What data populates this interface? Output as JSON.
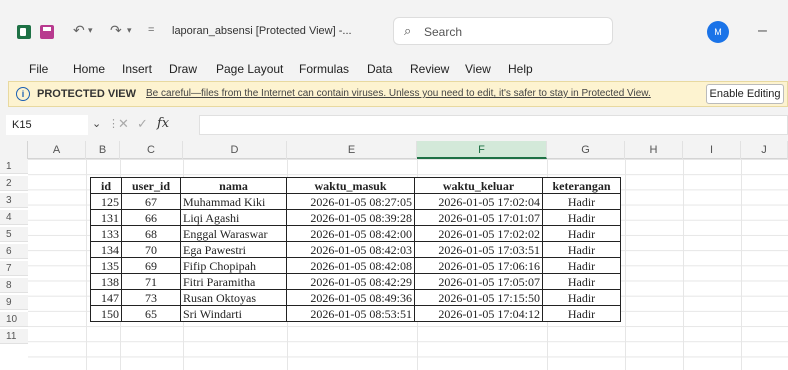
{
  "titlebar": {
    "undo_glyph": "↶",
    "redo_glyph": "↷",
    "dropdown_glyph": "▾",
    "customize_glyph": "=",
    "doc_title": "laporan_absensi [Protected View] -...",
    "search_placeholder": "Search",
    "avatar_initial": "M",
    "minimize_glyph": "–"
  },
  "menu": [
    "File",
    "Home",
    "Insert",
    "Draw",
    "Page Layout",
    "Formulas",
    "Data",
    "Review",
    "View",
    "Help"
  ],
  "protected_view": {
    "title": "PROTECTED VIEW",
    "message": "Be careful—files from the Internet can contain viruses. Unless you need to edit, it's safer to stay in Protected View.",
    "button": "Enable Editing"
  },
  "formula_bar": {
    "cell_ref": "K15",
    "fx": "fx",
    "value": ""
  },
  "columns": [
    "A",
    "B",
    "C",
    "D",
    "E",
    "F",
    "G",
    "H",
    "I",
    "J"
  ],
  "active_column": "F",
  "rows": [
    "1",
    "2",
    "3",
    "4",
    "5",
    "6",
    "7",
    "8",
    "9",
    "10",
    "11"
  ],
  "table": {
    "headers": [
      "id",
      "user_id",
      "nama",
      "waktu_masuk",
      "waktu_keluar",
      "keterangan"
    ],
    "rows": [
      [
        "125",
        "67",
        "Muhammad Kiki",
        "2026-01-05 08:27:05",
        "2026-01-05 17:02:04",
        "Hadir"
      ],
      [
        "131",
        "66",
        "Liqi Agashi",
        "2026-01-05 08:39:28",
        "2026-01-05 17:01:07",
        "Hadir"
      ],
      [
        "133",
        "68",
        "Enggal Waraswar",
        "2026-01-05 08:42:00",
        "2026-01-05 17:02:02",
        "Hadir"
      ],
      [
        "134",
        "70",
        "Ega Pawestri",
        "2026-01-05 08:42:03",
        "2026-01-05 17:03:51",
        "Hadir"
      ],
      [
        "135",
        "69",
        "Fifip Chopipah",
        "2026-01-05 08:42:08",
        "2026-01-05 17:06:16",
        "Hadir"
      ],
      [
        "138",
        "71",
        "Fitri Paramitha",
        "2026-01-05 08:42:29",
        "2026-01-05 17:05:07",
        "Hadir"
      ],
      [
        "147",
        "73",
        "Rusan Oktoyas",
        "2026-01-05 08:49:36",
        "2026-01-05 17:15:50",
        "Hadir"
      ],
      [
        "150",
        "65",
        "Sri Windarti",
        "2026-01-05 08:53:51",
        "2026-01-05 17:04:12",
        "Hadir"
      ]
    ]
  },
  "colors": {
    "excel_green": "#1e7145",
    "protected_bar": "#fdf3d0",
    "avatar": "#1a73e8"
  }
}
